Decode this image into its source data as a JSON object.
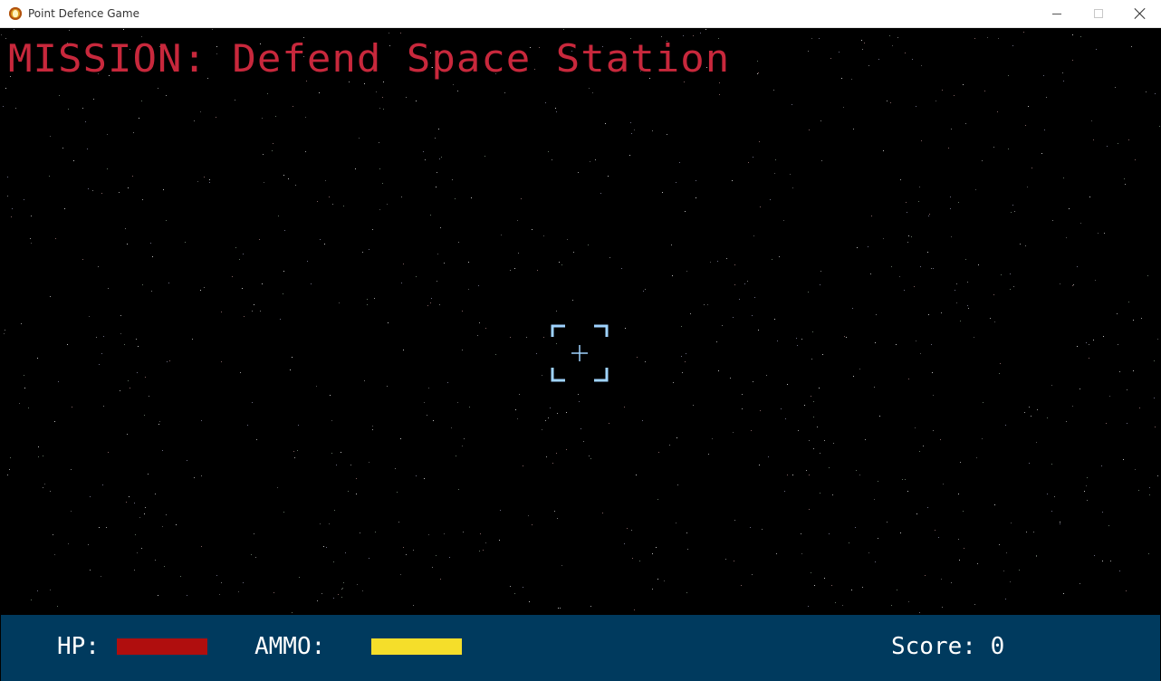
{
  "window": {
    "title": "Point Defence Game",
    "icon": "app-logo-icon",
    "controls": [
      "minimize-icon",
      "maximize-icon",
      "close-icon"
    ]
  },
  "game": {
    "mission_text": "MISSION: Defend Space Station",
    "mission_color": "#c8283c",
    "background_color": "#000000",
    "crosshair_color": "#9fd3ff"
  },
  "hud": {
    "background_color": "#003a5e",
    "hp_label": "HP:",
    "hp_level": 1.0,
    "hp_color": "#b00e0e",
    "ammo_label": "AMMO:",
    "ammo_level": 1.0,
    "ammo_color": "#f5de2a",
    "score_prefix": "Score: ",
    "score_value": "0"
  }
}
